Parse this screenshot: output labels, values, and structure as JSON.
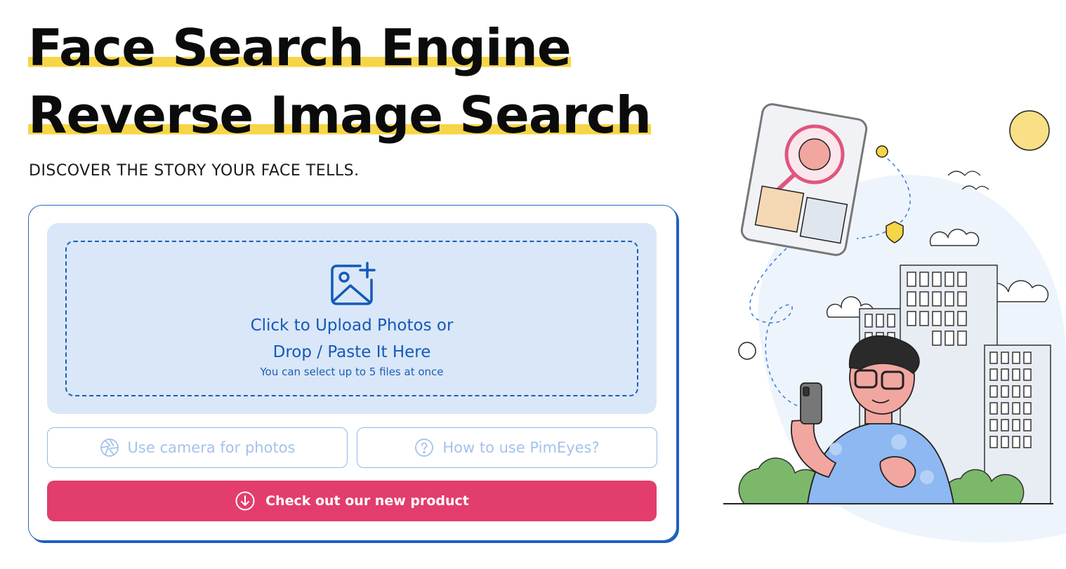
{
  "hero": {
    "title_line1": "Face Search Engine",
    "title_line2": "Reverse Image Search",
    "subtitle": "DISCOVER THE STORY YOUR FACE TELLS."
  },
  "upload": {
    "line1": "Click to Upload Photos or",
    "line2": "Drop / Paste It Here",
    "hint": "You can select up to 5 files at once",
    "icon": "image-add-icon"
  },
  "buttons": {
    "camera_label": "Use camera for photos",
    "camera_icon": "camera-aperture-icon",
    "howto_label": "How to use PimEyes?",
    "howto_icon": "question-circle-icon",
    "cta_label": "Check out our new product",
    "cta_icon": "arrow-down-circle-icon"
  },
  "colors": {
    "highlight": "#f6d547",
    "primary_blue": "#1559b7",
    "upload_bg": "#d9e7f8",
    "cta": "#e23d6d",
    "ghost_text": "#a4c2ea"
  }
}
